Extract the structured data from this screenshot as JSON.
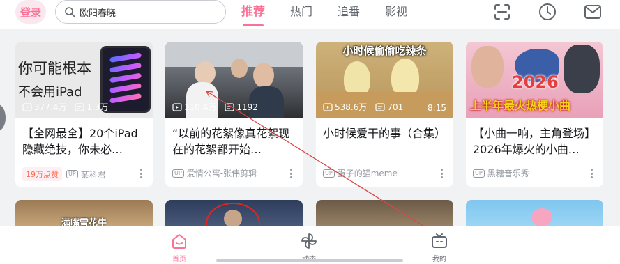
{
  "header": {
    "login_label": "登录",
    "search_text": "欧阳春晓",
    "tabs": [
      {
        "label": "推荐",
        "active": true
      },
      {
        "label": "热门",
        "active": false
      },
      {
        "label": "追番",
        "active": false
      },
      {
        "label": "影视",
        "active": false
      }
    ],
    "icons": [
      "scan-icon",
      "history-clock-icon",
      "message-mail-icon"
    ]
  },
  "cards": [
    {
      "thumb_text": {
        "line1": "你可能根本",
        "line2": "不会用iPad"
      },
      "views": "377.4万",
      "danmaku": "1.3万",
      "duration": "",
      "title": "【全网最全】20个iPad隐藏绝技，你未必…",
      "badge": "19万点赞",
      "author": "某科君"
    },
    {
      "thumb_text": {
        "line1": "",
        "line2": ""
      },
      "views": "110.4万",
      "danmaku": "1192",
      "duration": "",
      "title": "“以前的花絮像真花絮现在的花絮都开始…",
      "badge": "",
      "author": "爱情公寓-张伟剪辑"
    },
    {
      "thumb_text": {
        "line1": "小时候偷偷吃辣条",
        "line2": ""
      },
      "views": "538.6万",
      "danmaku": "701",
      "duration": "8:15",
      "title": "小时候爱干的事（合集）",
      "badge": "",
      "author": "蛋子的猫meme"
    },
    {
      "thumb_text": {
        "line1": "2026",
        "line2": "上半年最火热梗小曲"
      },
      "views": "",
      "danmaku": "",
      "duration": "",
      "title": "【小曲一响，主角登场】2026年爆火的小曲…",
      "badge": "",
      "author": "黑糖音乐秀"
    }
  ],
  "row2_cards": [
    {
      "thumb_text": "满嘴雪花牛"
    },
    {
      "thumb_text": ""
    },
    {
      "thumb_text": ""
    },
    {
      "thumb_text": ""
    }
  ],
  "bottom_nav": [
    {
      "label": "首页",
      "active": true
    },
    {
      "label": "动态",
      "active": false
    },
    {
      "label": "我的",
      "active": false
    }
  ],
  "colors": {
    "accent": "#fb7299",
    "text": "#18191c",
    "muted": "#9499a0"
  }
}
